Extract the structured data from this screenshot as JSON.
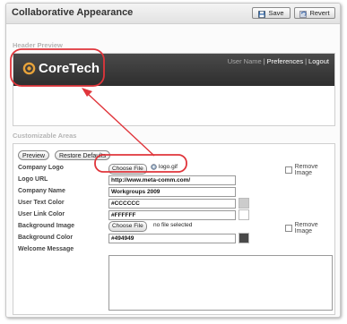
{
  "page": {
    "title": "Collaborative Appearance",
    "save_label": "Save",
    "revert_label": "Revert"
  },
  "preview": {
    "section_label": "Header Preview",
    "logo_text": "CoreTech",
    "user_name": "User Name",
    "preferences": "Preferences",
    "logout": "Logout",
    "separator": "|"
  },
  "areas": {
    "section_label": "Customizable Areas",
    "preview_button": "Preview",
    "restore_button": "Restore Defaults",
    "company_logo": {
      "label": "Company Logo",
      "choose_file": "Choose File",
      "file_name": "logo.gif",
      "remove_label": "Remove Image"
    },
    "logo_url": {
      "label": "Logo URL",
      "value": "http://www.meta-comm.com/"
    },
    "company_name": {
      "label": "Company Name",
      "value": "Workgroups 2009"
    },
    "user_text_color": {
      "label": "User Text Color",
      "value": "#CCCCCC"
    },
    "user_link_color": {
      "label": "User Link Color",
      "value": "#FFFFFF"
    },
    "background_image": {
      "label": "Background Image",
      "choose_file": "Choose File",
      "file_note": "no file selected",
      "remove_label": "Remove Image"
    },
    "background_color": {
      "label": "Background Color",
      "value": "#494949"
    },
    "welcome_message": {
      "label": "Welcome Message",
      "value": ""
    }
  },
  "colors": {
    "annotation": "#e0353b",
    "header_bg": "#494949",
    "user_text": "#CCCCCC",
    "user_link": "#FFFFFF"
  },
  "icons": {
    "save": "floppy-disk-icon",
    "revert": "undo-icon",
    "logo": "coretech-logo-icon",
    "file": "gif-file-icon"
  }
}
